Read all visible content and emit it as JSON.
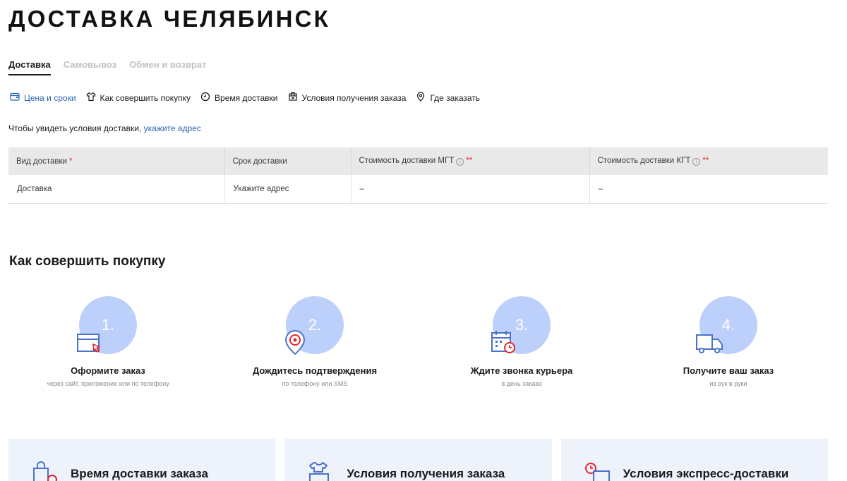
{
  "page": {
    "title": "ДОСТАВКА ЧЕЛЯБИНСК"
  },
  "tabs": [
    {
      "label": "Доставка"
    },
    {
      "label": "Самовывоз"
    },
    {
      "label": "Обмен и возврат"
    }
  ],
  "anchors": [
    {
      "label": "Цена и сроки",
      "icon": "wallet-icon"
    },
    {
      "label": "Как совершить покупку",
      "icon": "shirt-icon"
    },
    {
      "label": "Время доставки",
      "icon": "clock-icon"
    },
    {
      "label": "Условия получения заказа",
      "icon": "box-icon"
    },
    {
      "label": "Где заказать",
      "icon": "location-pin-icon"
    }
  ],
  "address_note": {
    "text": "Чтобы увидеть условия доставки, ",
    "link": "укажите адрес"
  },
  "table": {
    "headers": {
      "type": "Вид доставки",
      "term": "Срок доставки",
      "cost_mgt": "Стоимость доставки МГТ",
      "cost_kgt": "Стоимость доставки КГТ",
      "required_mark": "*",
      "double_mark": "**",
      "info_mark": "i"
    },
    "row": {
      "type": "Доставка",
      "term": "Укажите адрес",
      "cost_mgt": "–",
      "cost_kgt": "–"
    }
  },
  "how_to": {
    "title": "Как совершить покупку",
    "steps": [
      {
        "number": "1.",
        "title": "Оформите заказ",
        "sub": "через сайт, приложение или по телефону",
        "icon": "card-cursor-icon"
      },
      {
        "number": "2.",
        "title": "Дождитесь подтверждения",
        "sub": "по телефону или SMS",
        "icon": "location-confirm-icon"
      },
      {
        "number": "3.",
        "title": "Ждите звонка курьера",
        "sub": "в день заказа",
        "icon": "calendar-clock-icon"
      },
      {
        "number": "4.",
        "title": "Получите ваш заказ",
        "sub": "из рук в руки",
        "icon": "truck-icon"
      }
    ]
  },
  "cards": [
    {
      "title": "Время доставки заказа",
      "icon": "bags-clock-icon"
    },
    {
      "title": "Условия получения заказа",
      "icon": "clothes-box-icon"
    },
    {
      "title": "Условия экспресс-доставки",
      "icon": "express-clock-icon"
    }
  ],
  "colors": {
    "accent": "#2b63b8",
    "circle": "#bcd0fb",
    "icon_blue": "#4a73c9",
    "icon_red": "#e0282e",
    "card_bg": "#eef2fb"
  }
}
